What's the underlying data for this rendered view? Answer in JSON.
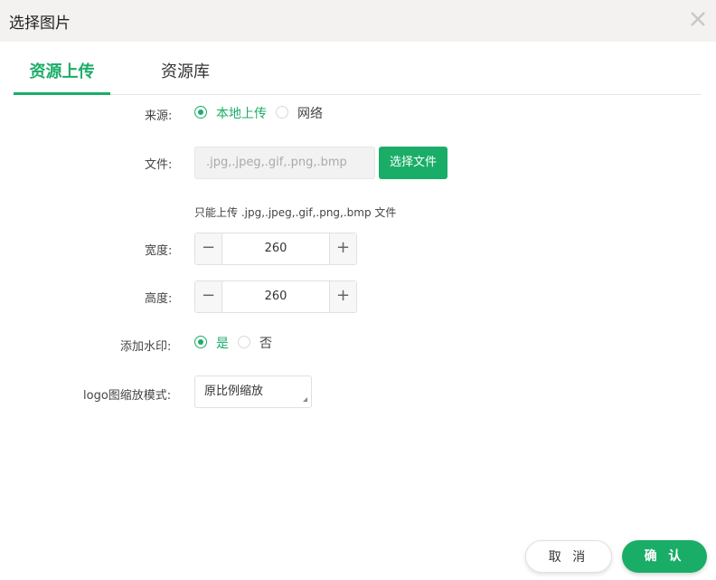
{
  "dialog": {
    "title": "选择图片"
  },
  "tabs": [
    {
      "label": "资源上传",
      "active": true
    },
    {
      "label": "资源库",
      "active": false
    }
  ],
  "form": {
    "source": {
      "label": "来源:",
      "options": [
        "本地上传",
        "网络"
      ],
      "selected": "本地上传"
    },
    "file": {
      "label": "文件:",
      "placeholder": ".jpg,.jpeg,.gif,.png,.bmp",
      "button": "选择文件",
      "hint": "只能上传 .jpg,.jpeg,.gif,.png,.bmp 文件"
    },
    "width": {
      "label": "宽度:",
      "value": "260",
      "minus": "−",
      "plus": "+"
    },
    "height": {
      "label": "高度:",
      "value": "260",
      "minus": "−",
      "plus": "+"
    },
    "watermark": {
      "label": "添加水印:",
      "options": [
        "是",
        "否"
      ],
      "selected": "是"
    },
    "logo_mode": {
      "label": "logo图缩放模式:",
      "value": "原比例缩放"
    }
  },
  "footer": {
    "cancel": "取 消",
    "confirm": "确 认"
  },
  "colors": {
    "accent": "#1aad68",
    "titlebar": "#f3f2f0"
  },
  "icons": {
    "close": "close-icon"
  }
}
